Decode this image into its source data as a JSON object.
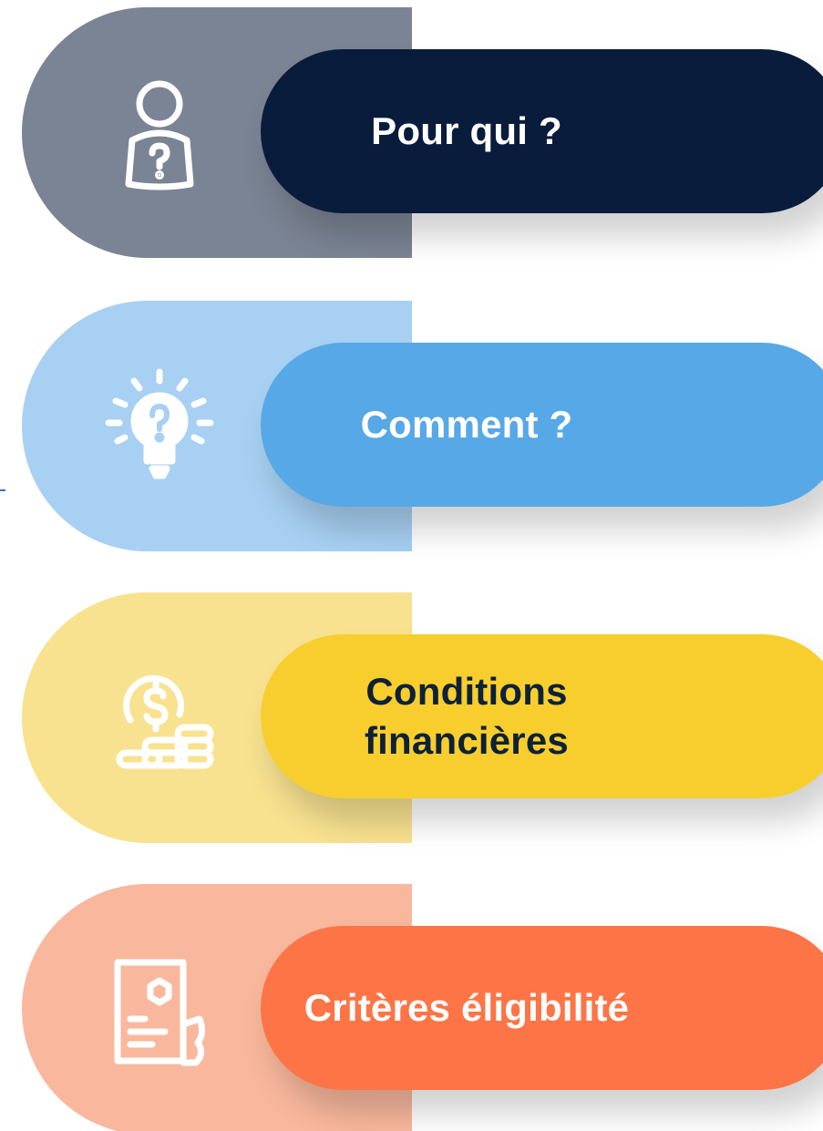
{
  "items": [
    {
      "label": "Pour qui ?",
      "icon": "person-question-icon",
      "colors": {
        "band": "#7b8494",
        "pill": "#0a1c3b",
        "text": "#ffffff"
      }
    },
    {
      "label": "Comment ?",
      "icon": "lightbulb-question-icon",
      "colors": {
        "band": "#a7d0f2",
        "pill": "#57a8e6",
        "text": "#ffffff"
      }
    },
    {
      "label": "Conditions financières",
      "icon": "coins-dollar-icon",
      "colors": {
        "band": "#f8e290",
        "pill": "#f7ce2e",
        "text": "#0d2137"
      }
    },
    {
      "label": "Critères éligibilité",
      "icon": "document-criteria-icon",
      "colors": {
        "band": "#f9b89d",
        "pill": "#fd7446",
        "text": "#ffffff"
      }
    }
  ]
}
